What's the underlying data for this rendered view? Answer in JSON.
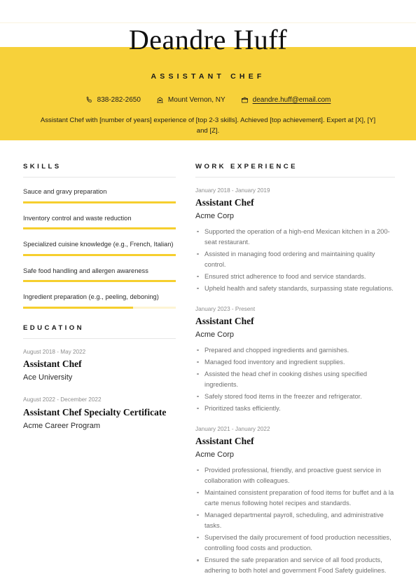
{
  "theme": {
    "accent": "#f7d13a",
    "accent_bar": "#f6cf2e",
    "accent_track": "#fdf4d4",
    "text": "#2d2d2d",
    "muted": "#8e8e8e"
  },
  "header": {
    "full_name": "Deandre Huff",
    "job_title": "Assistant Chef",
    "contacts": [
      {
        "icon": "phone-icon",
        "value": "838-282-2650"
      },
      {
        "icon": "location-icon",
        "value": "Mount Vernon, NY"
      },
      {
        "icon": "email-icon",
        "value": "deandre.huff@email.com"
      }
    ],
    "summary": "Assistant Chef with [number of years] experience of [top 2-3 skills]. Achieved [top achievement]. Expert at [X], [Y] and [Z]."
  },
  "skills": {
    "title": "Skills",
    "items": [
      {
        "label": "Sauce and gravy preparation",
        "level": 100
      },
      {
        "label": "Inventory control and waste reduction",
        "level": 100
      },
      {
        "label": "Specialized cuisine knowledge (e.g., French, Italian)",
        "level": 100
      },
      {
        "label": "Safe food handling and allergen awareness",
        "level": 100
      },
      {
        "label": "Ingredient preparation (e.g., peeling, deboning)",
        "level": 72
      }
    ]
  },
  "education": {
    "title": "Education",
    "items": [
      {
        "date": "August 2018 - May 2022",
        "role": "Assistant Chef",
        "org": "Ace University"
      },
      {
        "date": "August 2022 - December 2022",
        "role": "Assistant Chef Specialty Certificate",
        "org": "Acme Career Program"
      }
    ]
  },
  "work_experience": {
    "title": "Work Experience",
    "items": [
      {
        "date": "January 2018 - January 2019",
        "role": "Assistant Chef",
        "org": "Acme Corp",
        "bullets": [
          "Supported the operation of a high-end Mexican kitchen in a 200-seat restaurant.",
          "Assisted in managing food ordering and maintaining quality control.",
          "Ensured strict adherence to food and service standards.",
          "Upheld health and safety standards, surpassing state regulations."
        ]
      },
      {
        "date": "January 2023 - Present",
        "role": "Assistant Chef",
        "org": "Acme Corp",
        "bullets": [
          "Prepared and chopped ingredients and garnishes.",
          "Managed food inventory and ingredient supplies.",
          "Assisted the head chef in cooking dishes using specified ingredients.",
          "Safely stored food items in the freezer and refrigerator.",
          "Prioritized tasks efficiently."
        ]
      },
      {
        "date": "January 2021 - January 2022",
        "role": "Assistant Chef",
        "org": "Acme Corp",
        "bullets": [
          "Provided professional, friendly, and proactive guest service in collaboration with colleagues.",
          "Maintained consistent preparation of food items for buffet and à la carte menus following hotel recipes and standards.",
          "Managed departmental payroll, scheduling, and administrative tasks.",
          "Supervised the daily procurement of food production necessities, controlling food costs and production.",
          "Ensured the safe preparation and service of all food products, adhering to both hotel and government Food Safety guidelines."
        ]
      }
    ]
  }
}
